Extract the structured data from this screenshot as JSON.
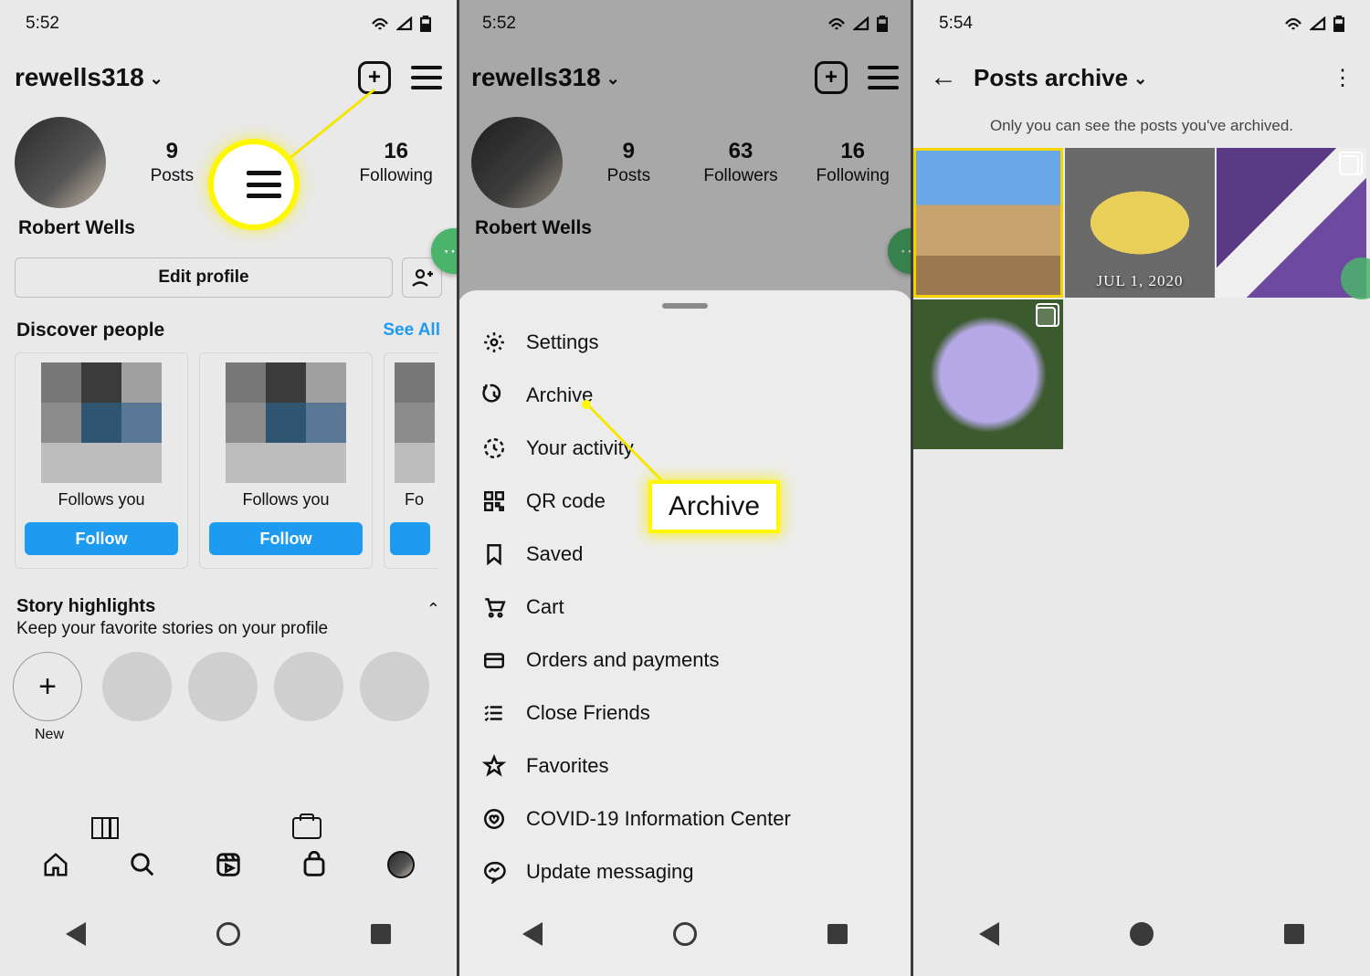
{
  "status": {
    "time1": "5:52",
    "time2": "5:52",
    "time3": "5:54"
  },
  "profile": {
    "username": "rewells318",
    "display_name": "Robert Wells",
    "stats": [
      {
        "num": "9",
        "label": "Posts"
      },
      {
        "num": "63",
        "label": "Followers"
      },
      {
        "num": "16",
        "label": "Following"
      }
    ],
    "edit": "Edit profile",
    "discover": "Discover people",
    "see_all": "See All",
    "cards": [
      {
        "sub": "Follows you",
        "btn": "Follow"
      },
      {
        "sub": "Follows you",
        "btn": "Follow"
      },
      {
        "sub": "Fo",
        "btn": ""
      }
    ],
    "highlights_title": "Story highlights",
    "highlights_sub": "Keep your favorite stories on your profile",
    "highlight_new": "New"
  },
  "menu": {
    "callout": "Archive",
    "items": [
      "Settings",
      "Archive",
      "Your activity",
      "QR code",
      "Saved",
      "Cart",
      "Orders and payments",
      "Close Friends",
      "Favorites",
      "COVID-19 Information Center",
      "Update messaging"
    ]
  },
  "archive": {
    "title": "Posts archive",
    "subtitle": "Only you can see the posts you've archived.",
    "tiles": [
      {
        "selected": true,
        "date": "",
        "stack": false
      },
      {
        "selected": false,
        "date": "JUL 1, 2020",
        "stack": false
      },
      {
        "selected": false,
        "date": "",
        "stack": true
      },
      {
        "selected": false,
        "date": "",
        "stack": true
      }
    ]
  }
}
